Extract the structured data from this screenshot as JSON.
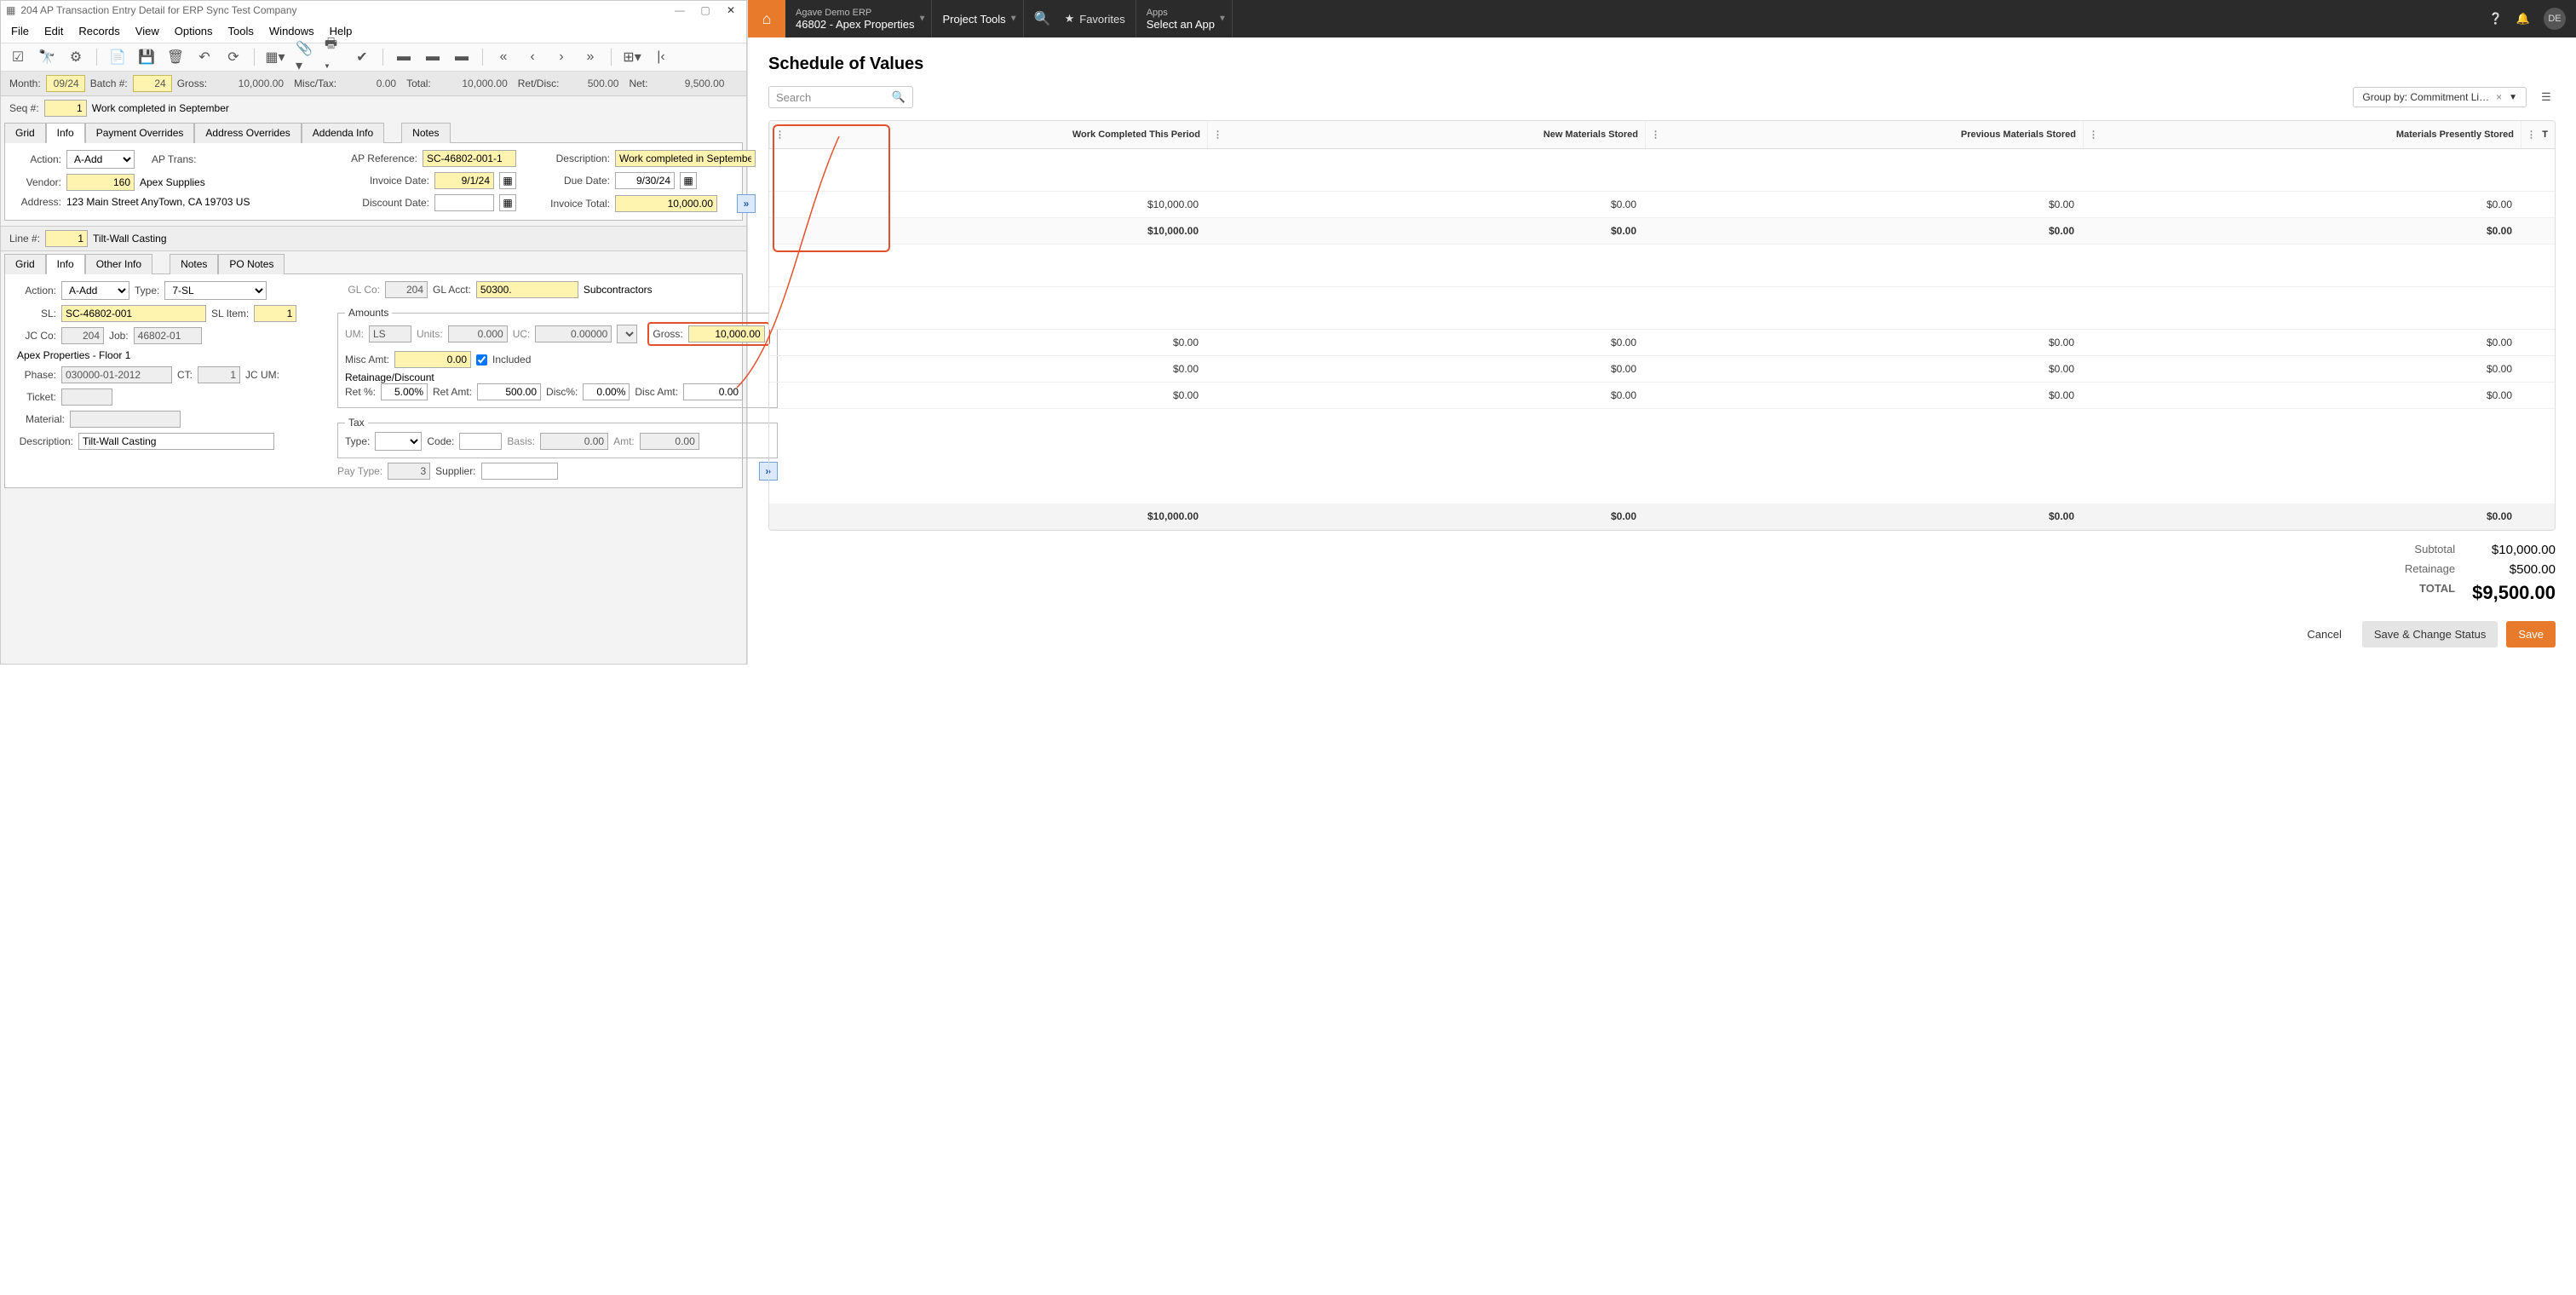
{
  "erp": {
    "window_title": "204 AP Transaction Entry Detail for ERP Sync Test Company",
    "menus": [
      "File",
      "Edit",
      "Records",
      "View",
      "Options",
      "Tools",
      "Windows",
      "Help"
    ],
    "header": {
      "month_lbl": "Month:",
      "month": "09/24",
      "batch_lbl": "Batch #:",
      "batch": "24",
      "gross_lbl": "Gross:",
      "gross": "10,000.00",
      "misc_lbl": "Misc/Tax:",
      "misc": "0.00",
      "total_lbl": "Total:",
      "total": "10,000.00",
      "ret_lbl": "Ret/Disc:",
      "ret": "500.00",
      "net_lbl": "Net:",
      "net": "9,500.00"
    },
    "seq_lbl": "Seq #:",
    "seq": "1",
    "seq_desc": "Work completed in September",
    "tabs1": [
      "Grid",
      "Info",
      "Payment Overrides",
      "Address Overrides",
      "Addenda Info",
      "Notes"
    ],
    "p1": {
      "action_lbl": "Action:",
      "action": "A-Add",
      "aptrans_lbl": "AP Trans:",
      "vendor_lbl": "Vendor:",
      "vendor_no": "160",
      "vendor_name": "Apex Supplies",
      "address_lbl": "Address:",
      "address": "123 Main Street  AnyTown,  CA   19703   US",
      "apref_lbl": "AP Reference:",
      "apref": "SC-46802-001-1",
      "invdate_lbl": "Invoice Date:",
      "invdate": "9/1/24",
      "discdate_lbl": "Discount Date:",
      "discdate": "",
      "desc_lbl": "Description:",
      "desc": "Work completed in September",
      "due_lbl": "Due Date:",
      "due": "9/30/24",
      "invtotal_lbl": "Invoice Total:",
      "invtotal": "10,000.00"
    },
    "line_lbl": "Line #:",
    "line_no": "1",
    "line_desc": "Tilt-Wall Casting",
    "tabs2": [
      "Grid",
      "Info",
      "Other Info",
      "Notes",
      "PO Notes"
    ],
    "p2": {
      "action_lbl": "Action:",
      "action": "A-Add",
      "type_lbl": "Type:",
      "type": "7-SL",
      "sl_lbl": "SL:",
      "sl": "SC-46802-001",
      "slitem_lbl": "SL Item:",
      "slitem": "1",
      "jcco_lbl": "JC Co:",
      "jcco": "204",
      "job_lbl": "Job:",
      "job": "46802-01",
      "project": "Apex Properties - Floor 1",
      "phase_lbl": "Phase:",
      "phase": "030000-01-2012",
      "ct_lbl": "CT:",
      "ct": "1",
      "jcum_lbl": "JC UM:",
      "ticket_lbl": "Ticket:",
      "material_lbl": "Material:",
      "desc_lbl": "Description:",
      "desc": "Tilt-Wall Casting",
      "glco_lbl": "GL Co:",
      "glco": "204",
      "glacct_lbl": "GL Acct:",
      "glacct": "50300.",
      "glacct_name": "Subcontractors",
      "amounts_legend": "Amounts",
      "um_lbl": "UM:",
      "um": "LS",
      "units_lbl": "Units:",
      "units": "0.000",
      "uc_lbl": "UC:",
      "uc": "0.00000",
      "gross_lbl": "Gross:",
      "gross": "10,000.00",
      "miscamt_lbl": "Misc Amt:",
      "miscamt": "0.00",
      "included_lbl": "Included",
      "retsec": "Retainage/Discount",
      "retpct_lbl": "Ret %:",
      "retpct": "5.00%",
      "retamt_lbl": "Ret Amt:",
      "retamt": "500.00",
      "discpct_lbl": "Disc%:",
      "discpct": "0.00%",
      "discamt_lbl": "Disc Amt:",
      "discamt": "0.00",
      "tax_legend": "Tax",
      "taxtype_lbl": "Type:",
      "code_lbl": "Code:",
      "basis_lbl": "Basis:",
      "basis": "0.00",
      "amt_lbl": "Amt:",
      "amt": "0.00",
      "paytype_lbl": "Pay Type:",
      "paytype": "3",
      "supplier_lbl": "Supplier:"
    }
  },
  "web": {
    "home_icon": "⌂",
    "org_t1": "Agave Demo ERP",
    "org_t2": "46802 - Apex Properties",
    "tools": "Project Tools",
    "fav": "Favorites",
    "apps_t1": "Apps",
    "apps_t2": "Select an App",
    "avatar": "DE",
    "page_title": "Schedule of Values",
    "search_ph": "Search",
    "groupby_lbl": "Group by: Commitment Li…",
    "columns": [
      "Work Completed This Period",
      "New Materials Stored",
      "Previous Materials Stored",
      "Materials Presently Stored",
      "T"
    ],
    "rows": [
      [
        "",
        "",
        "",
        "",
        ""
      ],
      [
        "$10,000.00",
        "$0.00",
        "$0.00",
        "$0.00",
        ""
      ],
      [
        "$10,000.00",
        "$0.00",
        "$0.00",
        "$0.00",
        ""
      ],
      [
        "",
        "",
        "",
        "",
        ""
      ],
      [
        "",
        "",
        "",
        "",
        ""
      ],
      [
        "$0.00",
        "$0.00",
        "$0.00",
        "$0.00",
        ""
      ],
      [
        "$0.00",
        "$0.00",
        "$0.00",
        "$0.00",
        ""
      ],
      [
        "$0.00",
        "$0.00",
        "$0.00",
        "$0.00",
        ""
      ]
    ],
    "totalrow": [
      "$10,000.00",
      "$0.00",
      "$0.00",
      "$0.00",
      ""
    ],
    "subtotal_k": "Subtotal",
    "subtotal_v": "$10,000.00",
    "retain_k": "Retainage",
    "retain_v": "$500.00",
    "total_k": "TOTAL",
    "total_v": "$9,500.00",
    "btn_cancel": "Cancel",
    "btn_savechg": "Save & Change Status",
    "btn_save": "Save"
  }
}
